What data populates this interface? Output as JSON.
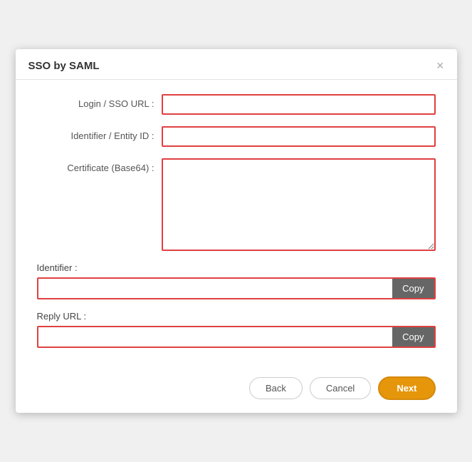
{
  "dialog": {
    "title": "SSO by SAML",
    "close_label": "×"
  },
  "form": {
    "login_url_label": "Login / SSO URL :",
    "login_url_value": "",
    "login_url_placeholder": "",
    "entity_id_label": "Identifier / Entity ID :",
    "entity_id_value": "",
    "entity_id_placeholder": "",
    "certificate_label": "Certificate (Base64) :",
    "certificate_value": "",
    "certificate_placeholder": ""
  },
  "identifier_section": {
    "label": "Identifier :",
    "value": "",
    "copy_label": "Copy"
  },
  "reply_url_section": {
    "label": "Reply URL :",
    "value": "",
    "copy_label": "Copy"
  },
  "footer": {
    "back_label": "Back",
    "cancel_label": "Cancel",
    "next_label": "Next"
  }
}
